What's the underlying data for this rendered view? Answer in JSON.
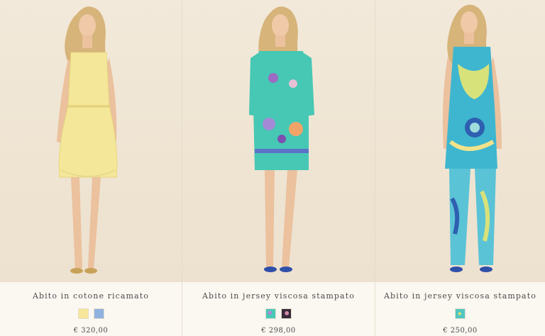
{
  "products": [
    {
      "title": "Abito in cotone ricamato",
      "price": "€ 320,00",
      "swatches": [
        {
          "color": "#f6e79a",
          "pattern": "solid",
          "name": "yellow"
        },
        {
          "color": "#8fb2de",
          "pattern": "solid",
          "name": "light-blue"
        }
      ],
      "garment_color": "#f4e79a"
    },
    {
      "title": "Abito in jersey viscosa stampato",
      "price": "€ 298,00",
      "swatches": [
        {
          "color": "#49c9b6",
          "pattern": "print",
          "name": "aqua-floral"
        },
        {
          "color": "#3a2b3a",
          "pattern": "print",
          "name": "dark-floral"
        }
      ],
      "garment_color": "#46c8b4"
    },
    {
      "title": "Abito in jersey viscosa stampato",
      "price": "€ 250,00",
      "swatches": [
        {
          "color": "#52c6c0",
          "pattern": "print",
          "name": "turquoise-paisley"
        }
      ],
      "garment_color": "#3fb6cf"
    }
  ]
}
